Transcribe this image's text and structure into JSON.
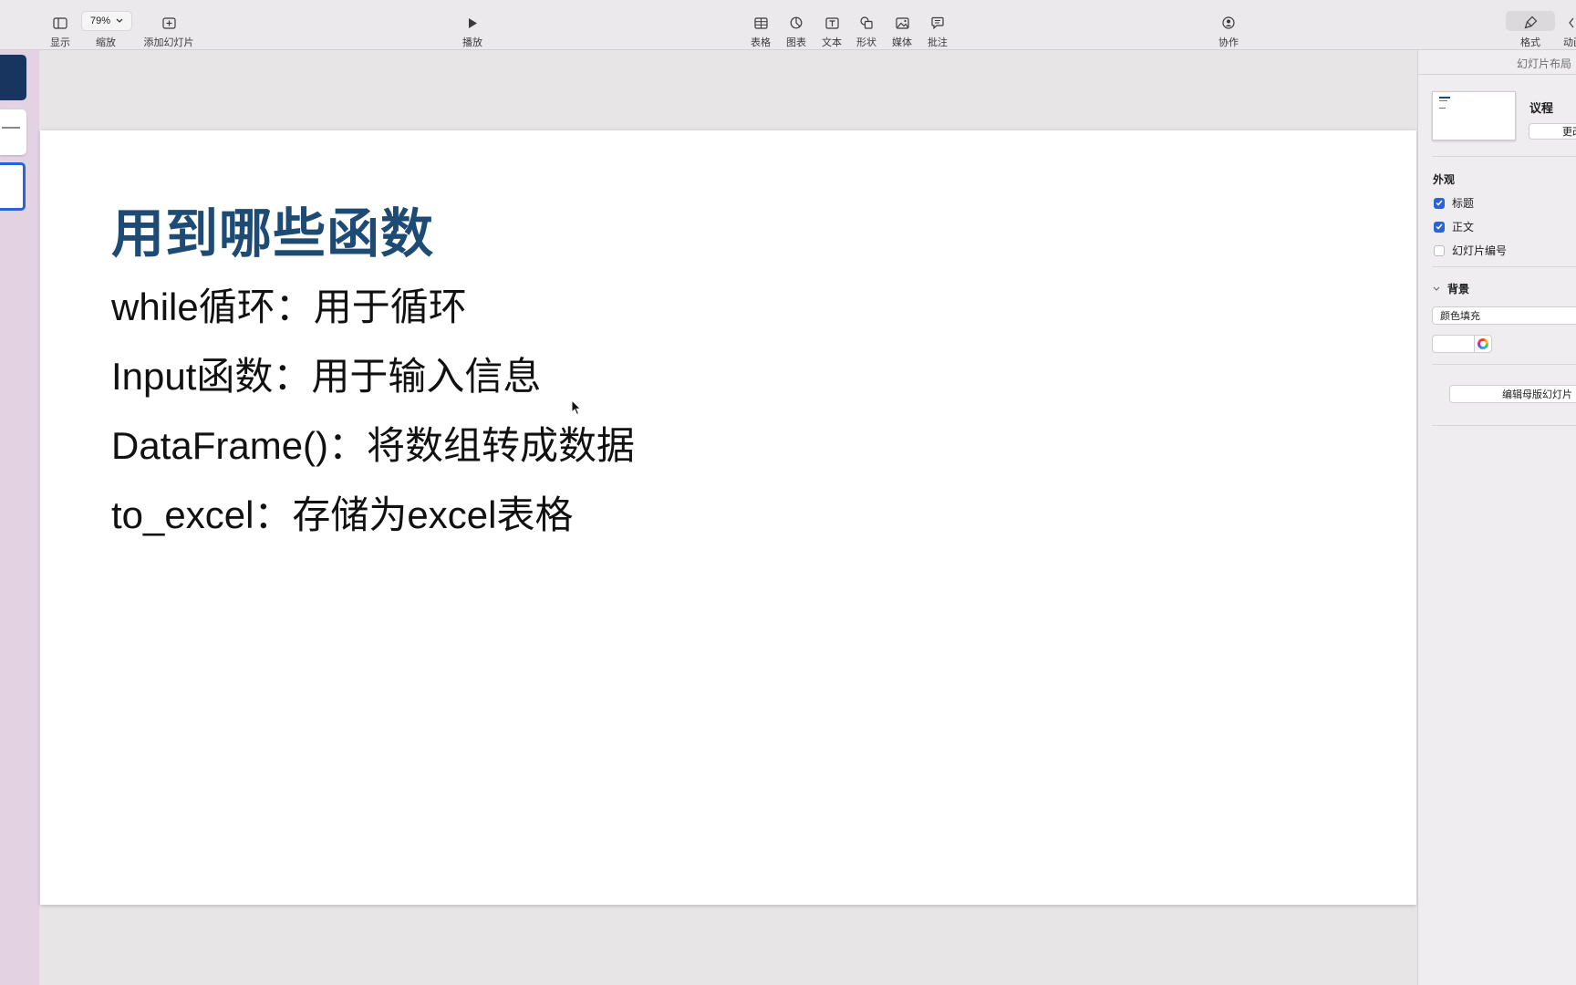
{
  "toolbar": {
    "view_label": "显示",
    "zoom_value": "79%",
    "zoom_label": "缩放",
    "add_slide_label": "添加幻灯片",
    "play_label": "播放",
    "table_label": "表格",
    "chart_label": "图表",
    "text_label": "文本",
    "shape_label": "形状",
    "media_label": "媒体",
    "comment_label": "批注",
    "collaborate_label": "协作",
    "format_label": "格式",
    "animate_label": "动画"
  },
  "slide": {
    "title": "用到哪些函数",
    "bullets": [
      "while循环：用于循环",
      "Input函数：用于输入信息",
      "DataFrame()：将数组转成数据",
      "to_excel：存储为excel表格"
    ]
  },
  "inspector": {
    "header": "幻灯片布局",
    "layout_name": "议程",
    "change_button": "更改",
    "appearance_heading": "外观",
    "title_checkbox": "标题",
    "body_checkbox": "正文",
    "slide_number_checkbox": "幻灯片编号",
    "background_heading": "背景",
    "fill_type": "颜色填充",
    "edit_master_button": "编辑母版幻灯片"
  },
  "colors": {
    "title_color": "#1e4b73",
    "accent_blue": "#2a64d4",
    "navigator_bg": "#e3d3e2"
  }
}
